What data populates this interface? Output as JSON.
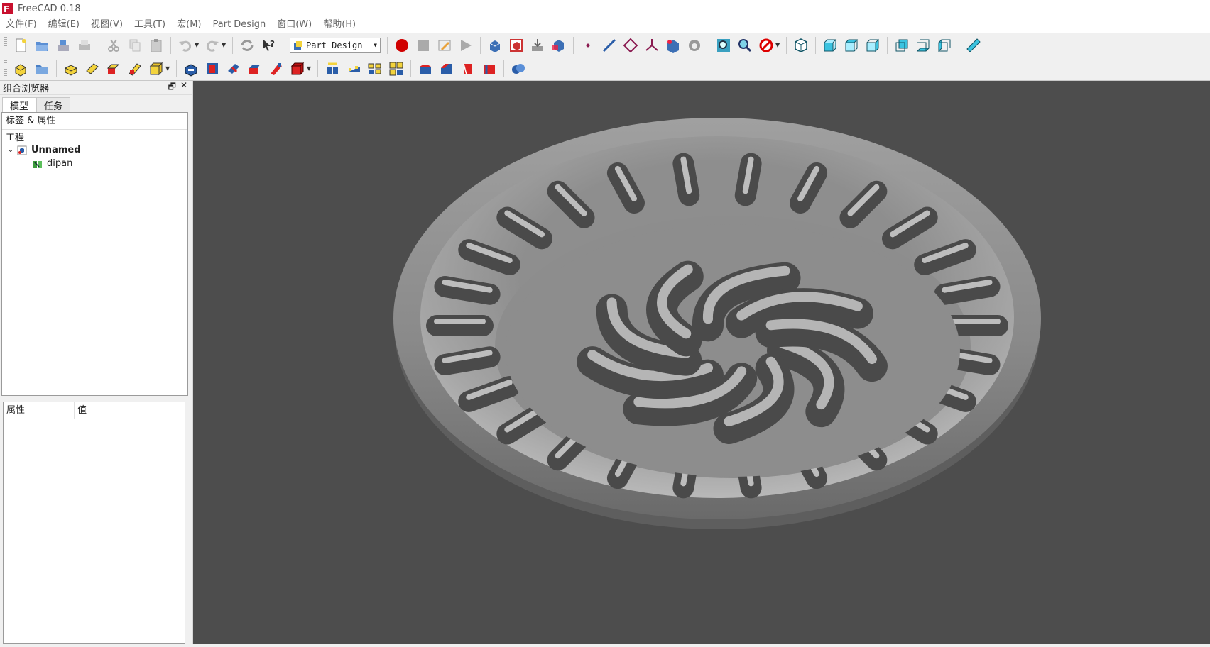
{
  "window": {
    "title": "FreeCAD 0.18"
  },
  "menu": [
    "文件(F)",
    "编辑(E)",
    "视图(V)",
    "工具(T)",
    "宏(M)",
    "Part Design",
    "窗口(W)",
    "帮助(H)"
  ],
  "toolbar": {
    "workbench": "Part Design"
  },
  "combo_view": {
    "title": "组合浏览器",
    "tabs": [
      "模型",
      "任务"
    ],
    "tree_header": "标签 & 属性",
    "tree_section": "工程",
    "tree_items": [
      {
        "label": "Unnamed",
        "icon": "document-icon"
      },
      {
        "label": "dipan",
        "icon": "body-icon"
      }
    ],
    "property_headers": {
      "property": "属性",
      "value": "值"
    }
  },
  "colors": {
    "viewport_bg": "#4d4d4d",
    "model_gray": "#9a9a9a",
    "record_red": "#d00000"
  }
}
